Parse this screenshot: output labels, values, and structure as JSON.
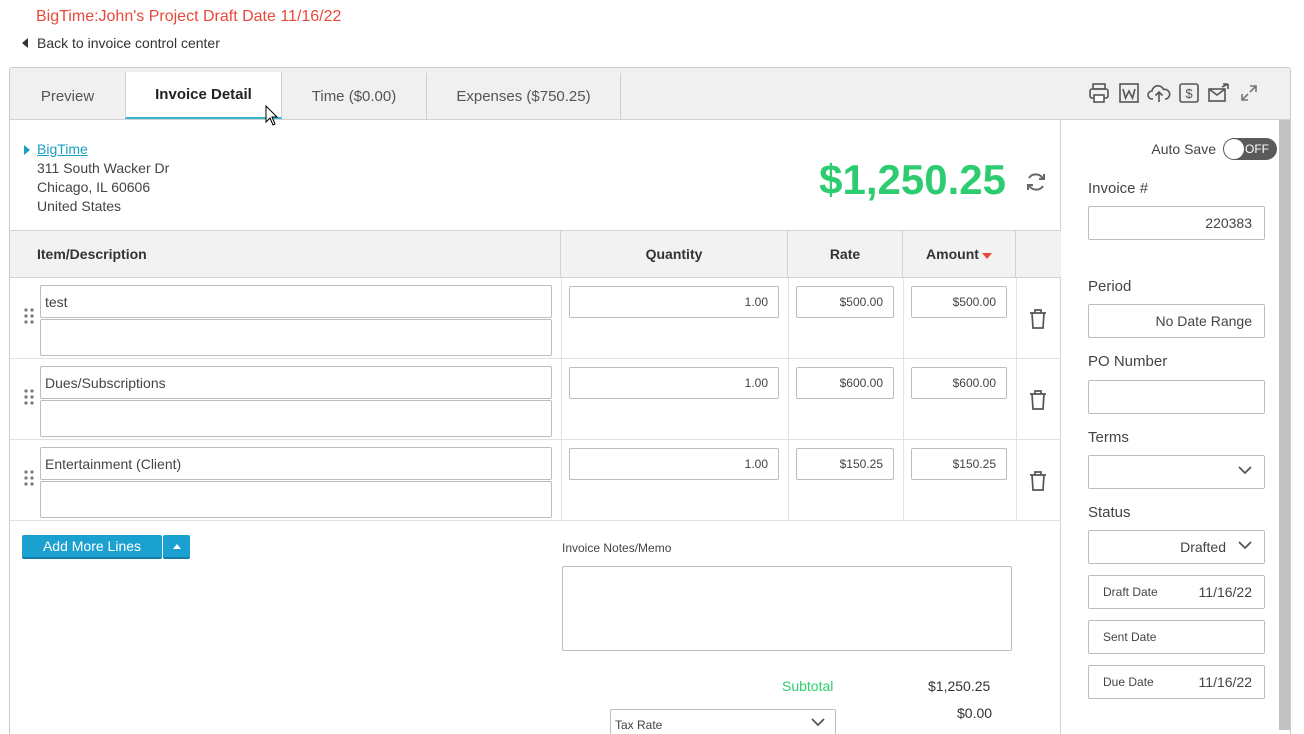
{
  "page_title": "BigTime:John's Project Draft Date 11/16/22",
  "back_link": "Back to invoice control center",
  "tabs": [
    {
      "label": "Preview"
    },
    {
      "label": "Invoice Detail"
    },
    {
      "label": "Time ($0.00)"
    },
    {
      "label": "Expenses ($750.25)"
    }
  ],
  "toolbar_icons": [
    "print-icon",
    "word-export-icon",
    "cloud-upload-icon",
    "payment-icon",
    "send-email-icon",
    "expand-icon"
  ],
  "client": {
    "name": "BigTime",
    "address": [
      "311 South Wacker Dr",
      "Chicago, IL 60606",
      "United States"
    ]
  },
  "invoice_total": "$1,250.25",
  "table": {
    "columns": [
      "Item/Description",
      "Quantity",
      "Rate",
      "Amount"
    ],
    "rows": [
      {
        "description": "test",
        "quantity": "1.00",
        "rate": "$500.00",
        "amount": "$500.00"
      },
      {
        "description": "Dues/Subscriptions",
        "quantity": "1.00",
        "rate": "$600.00",
        "amount": "$600.00"
      },
      {
        "description": "Entertainment (Client)",
        "quantity": "1.00",
        "rate": "$150.25",
        "amount": "$150.25"
      }
    ]
  },
  "add_more_lines": "Add More Lines",
  "notes_label": "Invoice Notes/Memo",
  "subtotal_label": "Subtotal",
  "subtotal_value": "$1,250.25",
  "tax_value": "$0.00",
  "tax_rate_placeholder": "Tax Rate",
  "sidebar": {
    "auto_save_label": "Auto Save",
    "auto_save_state": "OFF",
    "invoice_number_label": "Invoice #",
    "invoice_number": "220383",
    "period_label": "Period",
    "period_value": "No Date Range",
    "po_label": "PO Number",
    "po_value": "",
    "terms_label": "Terms",
    "terms_value": "",
    "status_label": "Status",
    "status_value": "Drafted",
    "draft_date_label": "Draft Date",
    "draft_date": "11/16/22",
    "sent_date_label": "Sent Date",
    "sent_date": "",
    "due_date_label": "Due Date",
    "due_date": "11/16/22"
  },
  "colors": {
    "title_red": "#e8493a",
    "total_green": "#2ecc71",
    "accent_blue": "#1ba1cf"
  }
}
